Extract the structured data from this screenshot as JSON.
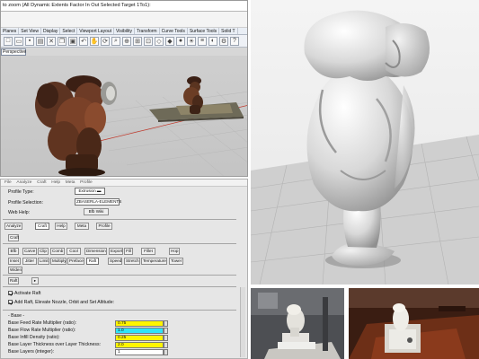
{
  "rhino": {
    "command_line": "to zoom (All Dynamic Extents Factor In Out Selected Target 1To1):",
    "tabs": [
      "Planes",
      "Set View",
      "Display",
      "Select",
      "Viewport Layout",
      "Visibility",
      "Transform",
      "Curve Tools",
      "Surface Tools",
      "Solid T"
    ],
    "viewport_tab": "Perspective"
  },
  "skeinforge": {
    "menu": [
      "File",
      "Analyze",
      "Craft",
      "Help",
      "Meta",
      "Profile"
    ],
    "profile_type_label": "Profile Type:",
    "profile_type_value": "Extrusion",
    "profile_selection_label": "Profile Selection:",
    "profile_selection_value": "ZBASERLA-ELEMENTS",
    "web_help_label": "Web Help:",
    "web_help_button": "Bfb Wiki",
    "main_buttons": [
      "Analyze",
      "Craft",
      "Help",
      "Meta",
      "Profile"
    ],
    "craft_row1": [
      "Bfb",
      "Carve",
      "Clip",
      "Comb",
      "Cool",
      "Dimension",
      "Export",
      "Fill",
      "Fillet",
      "Hop"
    ],
    "craft_row2": [
      "Inset",
      "Jitter",
      "Limit",
      "Multiply",
      "Preface",
      "Raft",
      "Speed",
      "Stretch",
      "Temperature",
      "Tower"
    ],
    "craft_row3": [
      "Widen"
    ],
    "selected_plugin": "Raft",
    "activate_raft": "Activate Raft",
    "add_raft": "Add Raft, Elevate Nozzle, Orbit and Set Altitude:",
    "base_header": "- Base -",
    "settings": [
      {
        "label": "Base Feed Rate Multiplier (ratio):",
        "value": "0.75",
        "color": "#fff500"
      },
      {
        "label": "Base Flow Rate Multiplier (ratio):",
        "value": "1.0",
        "color": "#2fe3f7"
      },
      {
        "label": "Base Infill Density (ratio):",
        "value": "0.25",
        "color": "#fff500"
      },
      {
        "label": "Base Layer Thickness over Layer Thickness:",
        "value": "2.0",
        "color": "#fff500"
      },
      {
        "label": "Base Layers (integer):",
        "value": "1",
        "color": "#ffffff"
      }
    ]
  }
}
